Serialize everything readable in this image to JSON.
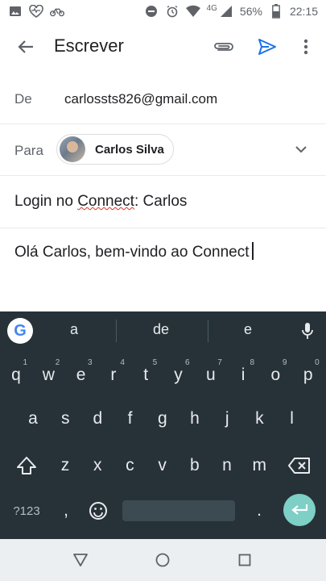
{
  "status_bar": {
    "battery": "56%",
    "network": "4G",
    "time": "22:15"
  },
  "app_bar": {
    "title": "Escrever",
    "icons": [
      "back-arrow-icon",
      "attachment-icon",
      "send-icon",
      "more-vert-icon"
    ]
  },
  "compose": {
    "from_label": "De",
    "from_value": "carlossts826@gmail.com",
    "to_label": "Para",
    "to_chip": "Carlos Silva",
    "subject_prefix": "Login no ",
    "subject_misspelled": "Connect",
    "subject_suffix": ": Carlos",
    "body": "Olá Carlos, bem-vindo ao Connect"
  },
  "keyboard": {
    "suggestions": [
      "a",
      "de",
      "e"
    ],
    "row1": [
      {
        "k": "q",
        "n": "1"
      },
      {
        "k": "w",
        "n": "2"
      },
      {
        "k": "e",
        "n": "3"
      },
      {
        "k": "r",
        "n": "4"
      },
      {
        "k": "t",
        "n": "5"
      },
      {
        "k": "y",
        "n": "6"
      },
      {
        "k": "u",
        "n": "7"
      },
      {
        "k": "i",
        "n": "8"
      },
      {
        "k": "o",
        "n": "9"
      },
      {
        "k": "p",
        "n": "0"
      }
    ],
    "row2": [
      "a",
      "s",
      "d",
      "f",
      "g",
      "h",
      "j",
      "k",
      "l"
    ],
    "row3": [
      "z",
      "x",
      "c",
      "v",
      "b",
      "n",
      "m"
    ],
    "symbols_key": "?123",
    "comma_key": ",",
    "period_key": "."
  }
}
